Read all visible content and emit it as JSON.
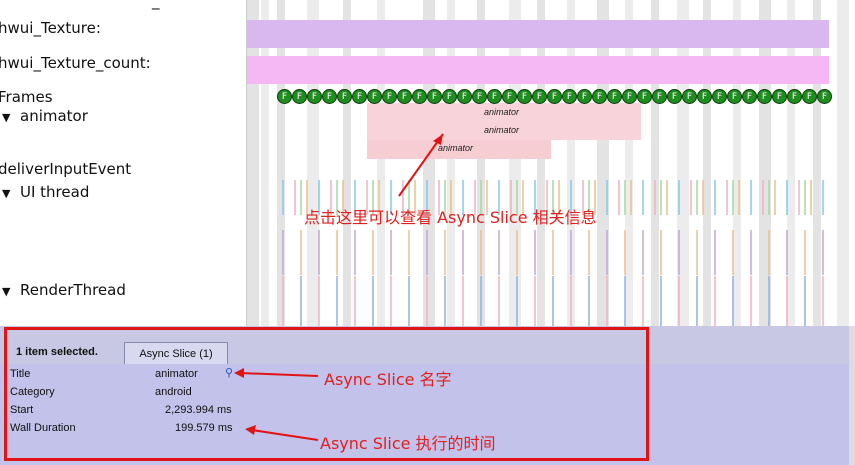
{
  "tracks": {
    "top_partial": "_",
    "texture": "hwui_Texture:",
    "texture_count": "hwui_Texture_count:",
    "frames": "Frames",
    "animator": "animator",
    "deliver": "deliverInputEvent",
    "ui_thread": "UI thread",
    "render_thread": "RenderThread",
    "expand_glyph": "▼"
  },
  "slices": {
    "animator_1": "animator",
    "animator_2": "animator",
    "animator_3": "animator"
  },
  "frame_glyph": "F",
  "frame_count": 37,
  "annotations": {
    "click_hint": "点击这里可以查看 Async Slice 相关信息",
    "name_hint": "Async Slice 名字",
    "duration_hint": "Async Slice 执行的时间"
  },
  "details": {
    "selection": "1 item selected.",
    "tab_label": "Async Slice (1)",
    "rows": [
      {
        "name": "Title",
        "value": "animator"
      },
      {
        "name": "Category",
        "value": "android"
      },
      {
        "name": "Start",
        "value": "2,293.994 ms"
      },
      {
        "name": "Wall Duration",
        "value": "199.579 ms"
      }
    ]
  },
  "colors": {
    "texture_track": "#d9b8f0",
    "texture_count_track": "#f6b8f4",
    "frame_dot": "#1f8d1f",
    "animator_slice": "#f8d4da",
    "highlight_red": "#e01414",
    "details_bg": "#c2c2ea"
  }
}
